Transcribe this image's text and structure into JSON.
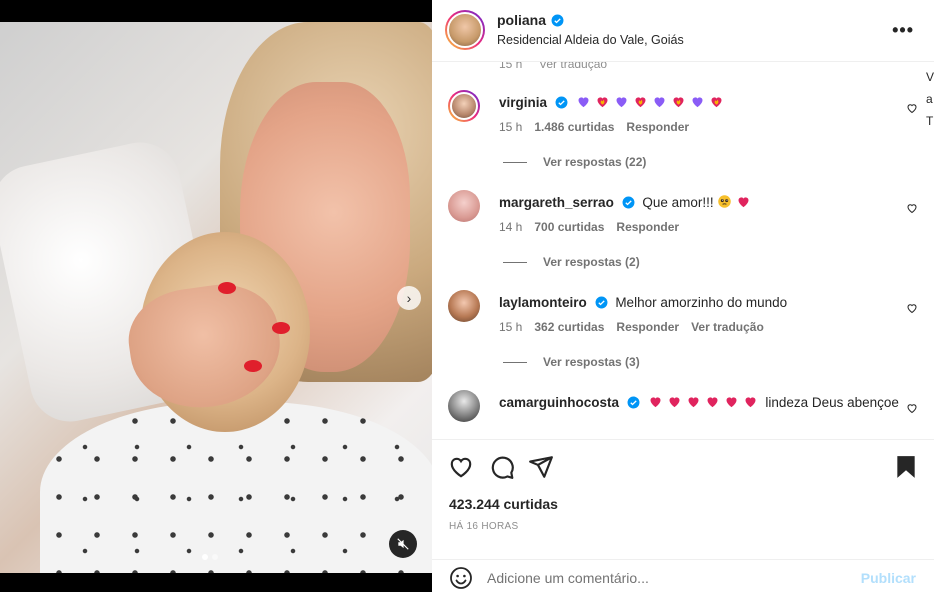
{
  "post": {
    "username": "poliana",
    "location": "Residencial Aldeia do Vale, Goiás",
    "likes": "423.244 curtidas",
    "time_ago": "HÁ 16 HORAS"
  },
  "partial_meta": {
    "time": "15 h",
    "translate": "Ver tradução"
  },
  "side_clip": [
    "V",
    "a",
    "T"
  ],
  "comments": [
    {
      "username": "virginia",
      "text": "",
      "emojis": [
        "purple-heart",
        "heart-on-fire",
        "purple-heart",
        "heart-on-fire",
        "purple-heart",
        "heart-on-fire",
        "purple-heart",
        "heart-on-fire"
      ],
      "time": "15 h",
      "likes": "1.486 curtidas",
      "reply": "Responder",
      "translate": "",
      "replies": "Ver respostas (22)"
    },
    {
      "username": "margareth_serrao",
      "text": "Que amor!!!",
      "emojis": [
        "pleading-face",
        "red-heart"
      ],
      "time": "14 h",
      "likes": "700 curtidas",
      "reply": "Responder",
      "translate": "",
      "replies": "Ver respostas (2)"
    },
    {
      "username": "laylamonteiro",
      "text": "Melhor amorzinho do mundo",
      "emojis": [],
      "time": "15 h",
      "likes": "362 curtidas",
      "reply": "Responder",
      "translate": "Ver tradução",
      "replies": "Ver respostas (3)"
    },
    {
      "username": "camarguinhocosta",
      "text": "lindeza Deus abençoe",
      "emojis": [
        "red-heart",
        "red-heart",
        "red-heart",
        "red-heart",
        "red-heart",
        "red-heart"
      ],
      "time": "",
      "likes": "",
      "reply": "",
      "translate": "",
      "replies": ""
    }
  ],
  "add_comment": {
    "placeholder": "Adicione um comentário...",
    "post_label": "Publicar"
  },
  "colors": {
    "verified": "#0095f6",
    "link_disabled": "#b2dffc",
    "secondary_text": "#737373",
    "red_heart": "#e0245e",
    "purple_heart": "#8a5cf6"
  }
}
